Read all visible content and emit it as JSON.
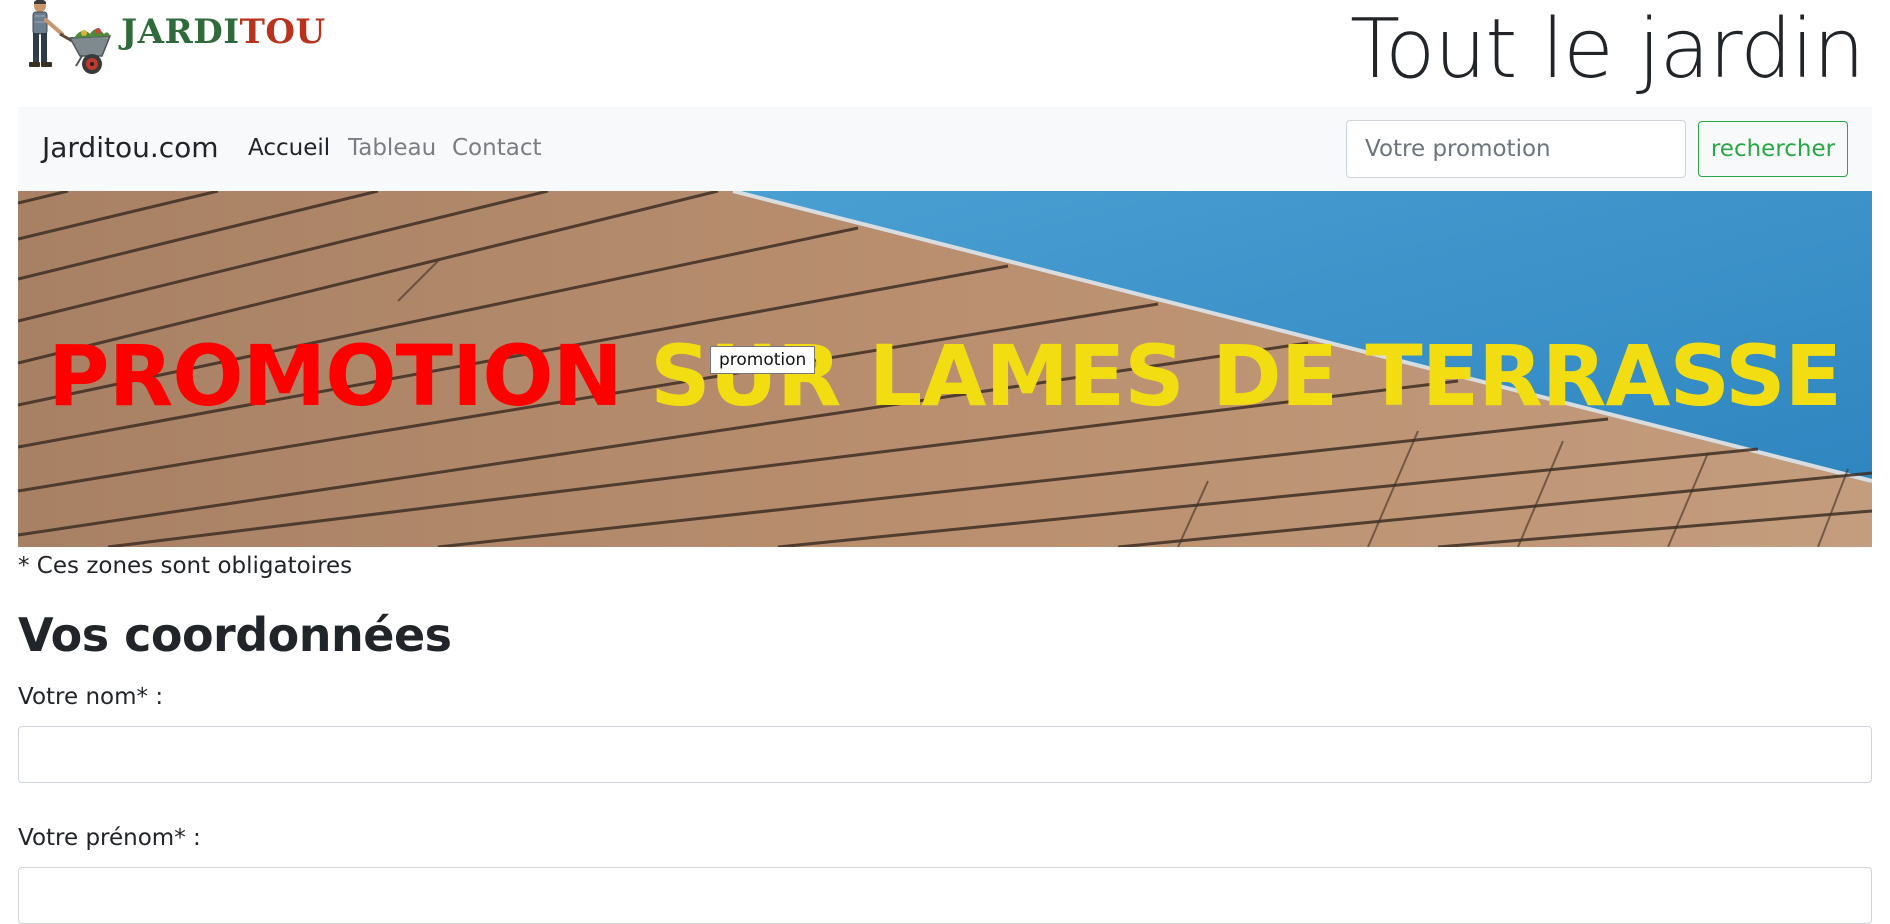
{
  "header": {
    "logo_text_part1": "JARDI",
    "logo_text_part2": "TOU",
    "tagline": "Tout le jardin"
  },
  "navbar": {
    "brand": "Jarditou.com",
    "links": [
      {
        "label": "Accueil",
        "active": true
      },
      {
        "label": "Tableau",
        "active": false
      },
      {
        "label": "Contact",
        "active": false
      }
    ],
    "search": {
      "placeholder": "Votre promotion",
      "value": "",
      "button_label": "rechercher"
    }
  },
  "banner": {
    "title_part1": "PROMOTION",
    "title_part2": "SUR LAMES DE TERRASSE",
    "tooltip": "promotion",
    "colors": {
      "part1": "#ff0000",
      "part2": "#f2dd12"
    }
  },
  "form": {
    "required_note": "* Ces zones sont obligatoires",
    "section_title": "Vos coordonnées",
    "fields": [
      {
        "label": "Votre nom* :",
        "value": ""
      },
      {
        "label": "Votre prénom* :",
        "value": ""
      }
    ]
  },
  "colors": {
    "navbar_bg": "#f8f9fa",
    "success": "#28a745",
    "text": "#212529"
  }
}
